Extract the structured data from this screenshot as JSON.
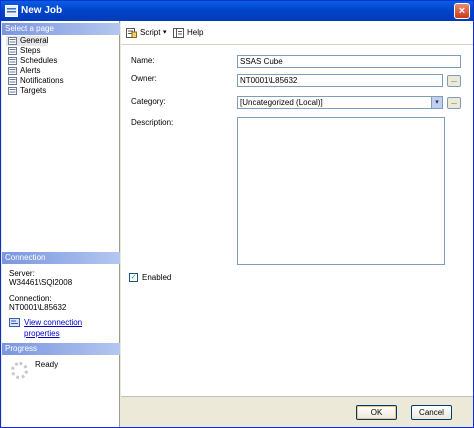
{
  "window": {
    "title": "New Job",
    "close_glyph": "×"
  },
  "sidebar": {
    "select_page_header": "Select a page",
    "items": [
      {
        "label": "General",
        "icon": "page-icon",
        "selected": true
      },
      {
        "label": "Steps",
        "icon": "page-icon"
      },
      {
        "label": "Schedules",
        "icon": "page-icon"
      },
      {
        "label": "Alerts",
        "icon": "page-icon"
      },
      {
        "label": "Notifications",
        "icon": "page-icon"
      },
      {
        "label": "Targets",
        "icon": "page-icon"
      }
    ],
    "connection_header": "Connection",
    "server_label": "Server:",
    "server_value": "W34461\\SQl2008",
    "connection_label": "Connection:",
    "connection_value": "NT0001\\L85632",
    "view_connection_link": "View connection properties",
    "progress_header": "Progress",
    "progress_status": "Ready"
  },
  "toolbar": {
    "script_label": "Script",
    "script_dropdown_glyph": "▾",
    "help_label": "Help"
  },
  "form": {
    "name_label": "Name:",
    "name_value": "SSAS Cube",
    "owner_label": "Owner:",
    "owner_value": "NT0001\\L85632",
    "category_label": "Category:",
    "category_value": "[Uncategorized (Local)]",
    "description_label": "Description:",
    "description_value": "",
    "enabled_label": "Enabled",
    "enabled_checked": true,
    "browse_glyph": "...",
    "dropdown_glyph": "▾",
    "check_glyph": "✓"
  },
  "buttons": {
    "ok": "OK",
    "cancel": "Cancel"
  }
}
